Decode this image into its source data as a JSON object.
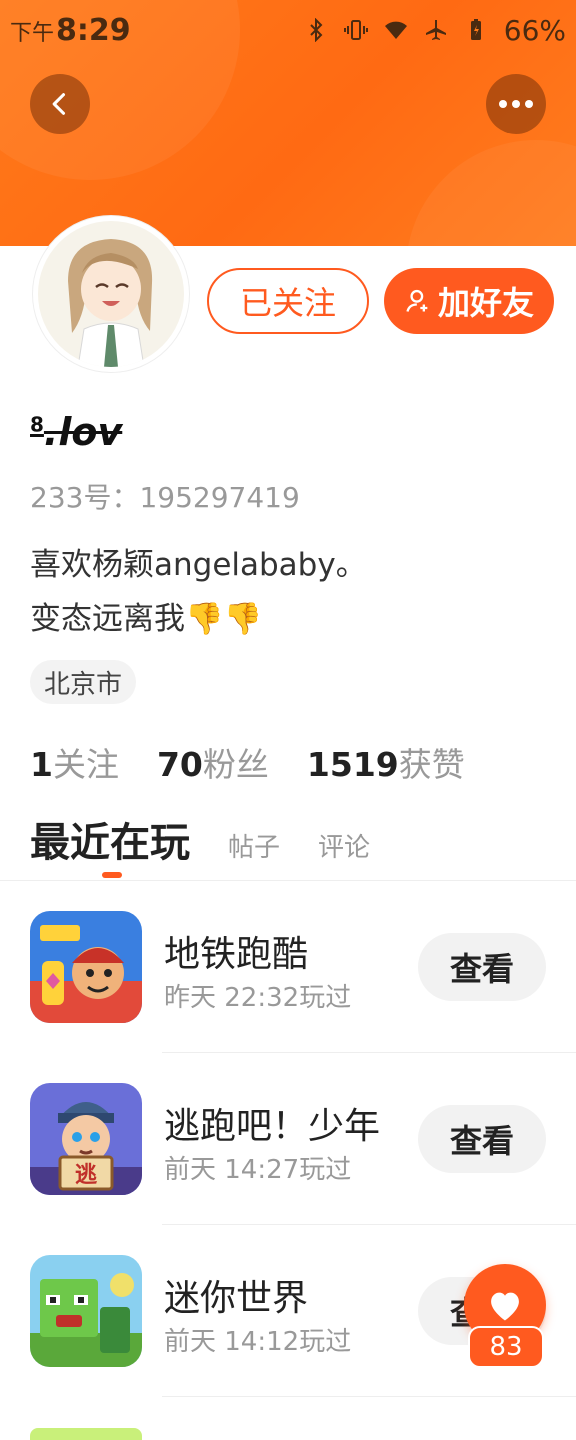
{
  "status_bar": {
    "period": "下午",
    "time": "8:29",
    "battery": "66%"
  },
  "profile": {
    "username": ".lov",
    "username_sup": "8",
    "id_label": "233号：195297419",
    "bio_line1": "喜欢杨颖angelababy。",
    "bio_line2": "变态远离我👎👎",
    "location": "北京市"
  },
  "actions": {
    "follow_label": "已关注",
    "add_friend_label": "加好友"
  },
  "stats": {
    "following_count": "1",
    "following_label": "关注",
    "fans_count": "70",
    "fans_label": "粉丝",
    "likes_count": "1519",
    "likes_label": "获赞"
  },
  "tabs": {
    "recent": "最近在玩",
    "posts": "帖子",
    "comments": "评论"
  },
  "games": [
    {
      "name": "地铁跑酷",
      "time": "昨天 22:32玩过",
      "button": "查看"
    },
    {
      "name": "逃跑吧！少年",
      "time": "前天 14:27玩过",
      "button": "查看"
    },
    {
      "name": "迷你世界",
      "time": "前天 14:12玩过",
      "button": "查看"
    }
  ],
  "like_fab": {
    "count": "83"
  },
  "colors": {
    "accent": "#ff5a1f",
    "header": "#ff6a13"
  }
}
